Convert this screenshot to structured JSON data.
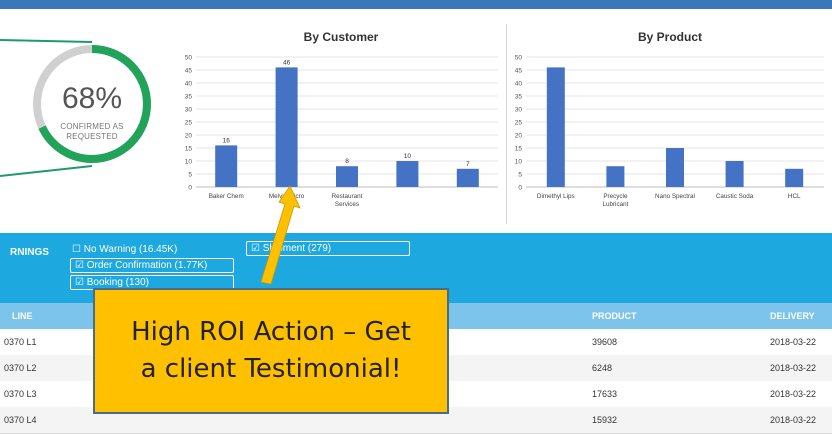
{
  "gauge": {
    "percent_value": 68,
    "percent_text": "68%",
    "label_line1": "CONFIRMED AS",
    "label_line2": "REQUESTED",
    "accent": "#21a35a",
    "track": "#d0d0d0"
  },
  "chart_data": [
    {
      "type": "bar",
      "title": "By Customer",
      "categories": [
        "Baker Chem",
        "Melvin Micro",
        "Restaurant Services",
        "",
        ""
      ],
      "category_lines": [
        [
          "Baker Chem"
        ],
        [
          "Melvin Micro"
        ],
        [
          "Restaurant",
          "Services"
        ],
        [
          ""
        ],
        [
          ""
        ]
      ],
      "values": [
        16,
        46,
        8,
        10,
        7
      ],
      "data_labels": [
        "16",
        "46",
        "8",
        "10",
        "7"
      ],
      "ylim": [
        0,
        50
      ],
      "yticks": [
        0,
        5,
        10,
        15,
        20,
        25,
        30,
        35,
        40,
        45,
        50
      ],
      "grid": true,
      "color": "#4472c4"
    },
    {
      "type": "bar",
      "title": "By Product",
      "categories": [
        "Dimethyl Lips",
        "Precycle Lubricant",
        "Nano Spectral",
        "Caustic Soda",
        "HCL"
      ],
      "category_lines": [
        [
          "Dimethyl Lips"
        ],
        [
          "Precycle",
          "Lubricant"
        ],
        [
          "Nano Spectral"
        ],
        [
          "Caustic Soda"
        ],
        [
          "HCL"
        ]
      ],
      "values": [
        46,
        8,
        15,
        10,
        7
      ],
      "ylim": [
        0,
        50
      ],
      "yticks": [
        0,
        5,
        10,
        15,
        20,
        25,
        30,
        35,
        40,
        45,
        50
      ],
      "grid": true,
      "color": "#4472c4"
    }
  ],
  "warnings": {
    "title": "RNINGS",
    "items": [
      {
        "label": "No Warning (16.45K)",
        "checked": "☐"
      },
      {
        "label": "Order Confirmation (1.77K)",
        "checked": "☑"
      },
      {
        "label": "Booking (130)",
        "checked": "☑"
      },
      {
        "label": "Shipment (279)",
        "checked": "☑"
      }
    ]
  },
  "table": {
    "headers": {
      "line": "LINE",
      "product": "PRODUCT",
      "delivery": "DELIVERY"
    },
    "rows": [
      {
        "line": "0370 L1",
        "product": "39608",
        "delivery": "2018-03-22"
      },
      {
        "line": "0370 L2",
        "product": "6248",
        "delivery": "2018-03-22"
      },
      {
        "line": "0370 L3",
        "product": "17633",
        "delivery": "2018-03-22"
      },
      {
        "line": "0370 L4",
        "product": "15932",
        "delivery": "2018-03-22"
      }
    ]
  },
  "callout": {
    "line1": "High ROI Action – Get",
    "line2": "a client Testimonial!",
    "fill": "#ffc000",
    "arrow_color": "#ffc000"
  }
}
